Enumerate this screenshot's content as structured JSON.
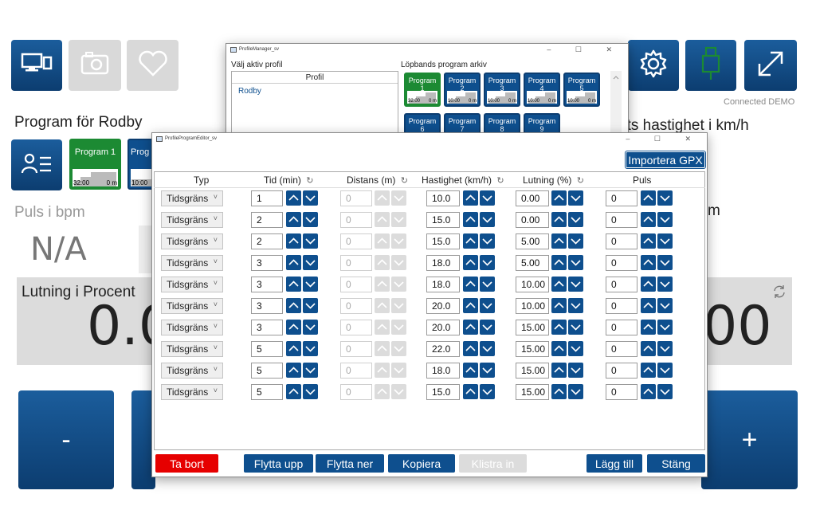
{
  "main": {
    "program_title": "Program för Rodby",
    "speed_title_partial": "ets hastighet i km/h",
    "pulse_label": "Puls i bpm",
    "pulse_value": "N/A",
    "right_partial_label": "m",
    "incline_label": "Lutning i Procent",
    "incline_value_partial": "0.0",
    "speed_value_partial": "00",
    "minus_label": "-",
    "plus_label": "+",
    "connection_status": "Connected DEMO",
    "program_tiles": [
      {
        "label": "Program 1",
        "time": "32:00",
        "dist": "0 m"
      },
      {
        "label": "Prog",
        "time": "10:00",
        "dist": ""
      }
    ]
  },
  "profile_manager": {
    "window_title": "ProfileManager_sv",
    "active_profile_label": "Välj aktiv profil",
    "profile_column_header": "Profil",
    "profiles": [
      "Rodby"
    ],
    "archive_label": "Löpbands program arkiv",
    "archive_programs": [
      {
        "label": "Program 1",
        "time": "32:00",
        "dist": "0 m",
        "active": true
      },
      {
        "label": "Program 2",
        "time": "10:00",
        "dist": "0 m",
        "active": false
      },
      {
        "label": "Program 3",
        "time": "10:00",
        "dist": "0 m",
        "active": false
      },
      {
        "label": "Program 4",
        "time": "10:00",
        "dist": "0 m",
        "active": false
      },
      {
        "label": "Program 5",
        "time": "10:00",
        "dist": "0 m",
        "active": false
      },
      {
        "label": "Program 6",
        "time": "",
        "dist": "",
        "active": false
      },
      {
        "label": "Program 7",
        "time": "",
        "dist": "",
        "active": false
      },
      {
        "label": "Program 8",
        "time": "",
        "dist": "",
        "active": false
      },
      {
        "label": "Program 9",
        "time": "",
        "dist": "",
        "active": false
      }
    ]
  },
  "editor": {
    "window_title": "ProfileProgramEditor_sv",
    "import_gpx": "Importera GPX",
    "headers": {
      "type": "Typ",
      "time": "Tid (min)",
      "distance": "Distans (m)",
      "speed": "Hastighet (km/h)",
      "incline": "Lutning (%)",
      "pulse": "Puls"
    },
    "rows": [
      {
        "type": "Tidsgräns",
        "time": "1",
        "distance": "0",
        "speed": "10.0",
        "incline": "0.00",
        "pulse": "0"
      },
      {
        "type": "Tidsgräns",
        "time": "2",
        "distance": "0",
        "speed": "15.0",
        "incline": "0.00",
        "pulse": "0"
      },
      {
        "type": "Tidsgräns",
        "time": "2",
        "distance": "0",
        "speed": "15.0",
        "incline": "5.00",
        "pulse": "0"
      },
      {
        "type": "Tidsgräns",
        "time": "3",
        "distance": "0",
        "speed": "18.0",
        "incline": "5.00",
        "pulse": "0"
      },
      {
        "type": "Tidsgräns",
        "time": "3",
        "distance": "0",
        "speed": "18.0",
        "incline": "10.00",
        "pulse": "0"
      },
      {
        "type": "Tidsgräns",
        "time": "3",
        "distance": "0",
        "speed": "20.0",
        "incline": "10.00",
        "pulse": "0"
      },
      {
        "type": "Tidsgräns",
        "time": "3",
        "distance": "0",
        "speed": "20.0",
        "incline": "15.00",
        "pulse": "0"
      },
      {
        "type": "Tidsgräns",
        "time": "5",
        "distance": "0",
        "speed": "22.0",
        "incline": "15.00",
        "pulse": "0"
      },
      {
        "type": "Tidsgräns",
        "time": "5",
        "distance": "0",
        "speed": "18.0",
        "incline": "15.00",
        "pulse": "0"
      },
      {
        "type": "Tidsgräns",
        "time": "5",
        "distance": "0",
        "speed": "15.0",
        "incline": "15.00",
        "pulse": "0"
      }
    ],
    "buttons": {
      "delete": "Ta bort",
      "move_up": "Flytta upp",
      "move_down": "Flytta ner",
      "copy": "Kopiera",
      "paste": "Klistra in",
      "add": "Lägg till",
      "close": "Stäng"
    }
  },
  "colors": {
    "brand_blue": "#0e4f8e",
    "active_green": "#1c8a33",
    "delete_red": "#e60000",
    "usb_green": "#1c8a33"
  }
}
